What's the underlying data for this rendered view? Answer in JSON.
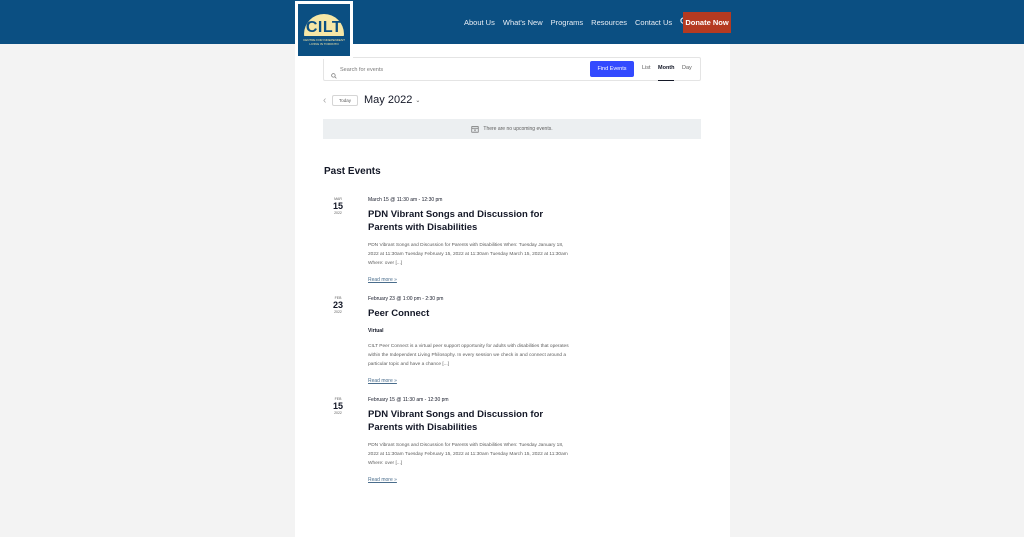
{
  "colors": {
    "header_bg": "#0b4f82",
    "donate_bg": "#b53a21",
    "find_button_bg": "#334aff",
    "logo_accent": "#f7e7a6"
  },
  "logo": {
    "title": "CILT",
    "subtitle": "Centre for Independent Living in Toronto"
  },
  "nav": {
    "items": [
      "About Us",
      "What's New",
      "Programs",
      "Resources",
      "Contact Us"
    ],
    "search_icon": "search-icon",
    "donate_label": "Donate Now"
  },
  "events_bar": {
    "search_placeholder": "Search for events",
    "search_value": "",
    "find_label": "Find Events",
    "views": [
      "List",
      "Month",
      "Day"
    ],
    "active_view": "Month"
  },
  "date_nav": {
    "today_label": "Today",
    "current_label": "May 2022"
  },
  "notice": {
    "icon": "calendar-x-icon",
    "text": "There are no upcoming events."
  },
  "past_events": {
    "heading": "Past Events",
    "items": [
      {
        "month": "Mar",
        "day": "15",
        "year": "2022",
        "time": "March 15 @ 11:30 am - 12:30 pm",
        "title": "PDN Vibrant Songs and Discussion for Parents with Disabilities",
        "venue": "",
        "description": "PDN Vibrant Songs and Discussion for Parents with Disabilities When: Tuesday January 18, 2022 at 11:30am Tuesday February 15, 2022 at 11:30am Tuesday March 15, 2022 at 11:30am Where: over [...]",
        "read_more": "Read more »"
      },
      {
        "month": "Feb",
        "day": "23",
        "year": "2022",
        "time": "February 23 @ 1:00 pm - 2:30 pm",
        "title": "Peer Connect",
        "venue": "Virtual",
        "description": "CILT Peer Connect is a virtual peer support opportunity for adults with disabilities that operates within the Independent Living Philosophy. In every session we check in and connect around a particular topic and have a chance [...]",
        "read_more": "Read more »"
      },
      {
        "month": "Feb",
        "day": "15",
        "year": "2022",
        "time": "February 15 @ 11:30 am - 12:30 pm",
        "title": "PDN Vibrant Songs and Discussion for Parents with Disabilities",
        "venue": "",
        "description": "PDN Vibrant Songs and Discussion for Parents with Disabilities When: Tuesday January 18, 2022 at 11:30am Tuesday February 15, 2022 at 11:30am Tuesday March 15, 2022 at 11:30am Where: over [...]",
        "read_more": "Read more »"
      }
    ]
  }
}
